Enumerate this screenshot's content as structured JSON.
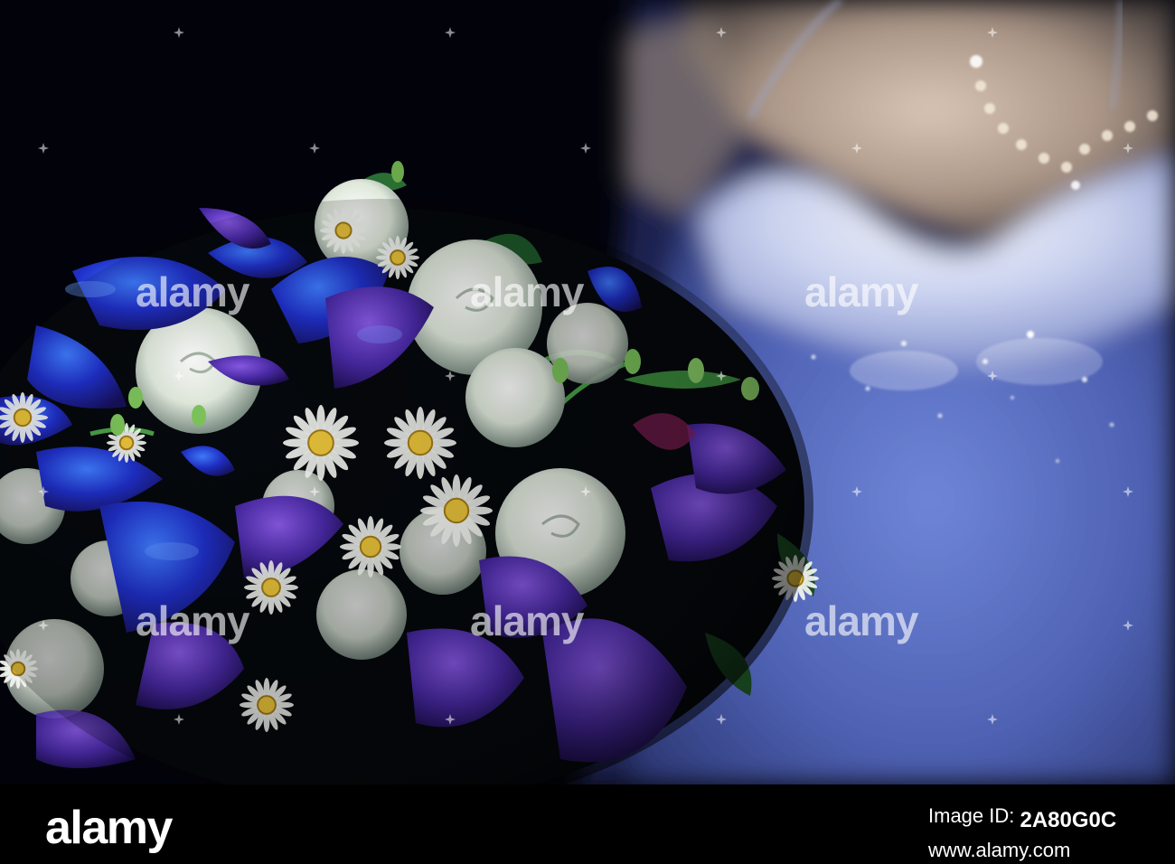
{
  "photo": {
    "colors": {
      "background": "#02030a",
      "orchid_blue": "#1a2fd0",
      "orchid_violet": "#4a2aa8",
      "rose_white": "#e9f0e6",
      "daisy_center": "#e8c23a",
      "leaf_green": "#1e5a2a",
      "dress_blue": "#5e74c8",
      "skin": "#b9a79a"
    },
    "watermark_text": "alamy"
  },
  "footer": {
    "brand": "alamy",
    "image_id_label": "Image ID:",
    "image_id": "2A80G0C",
    "site_url": "www.alamy.com"
  }
}
